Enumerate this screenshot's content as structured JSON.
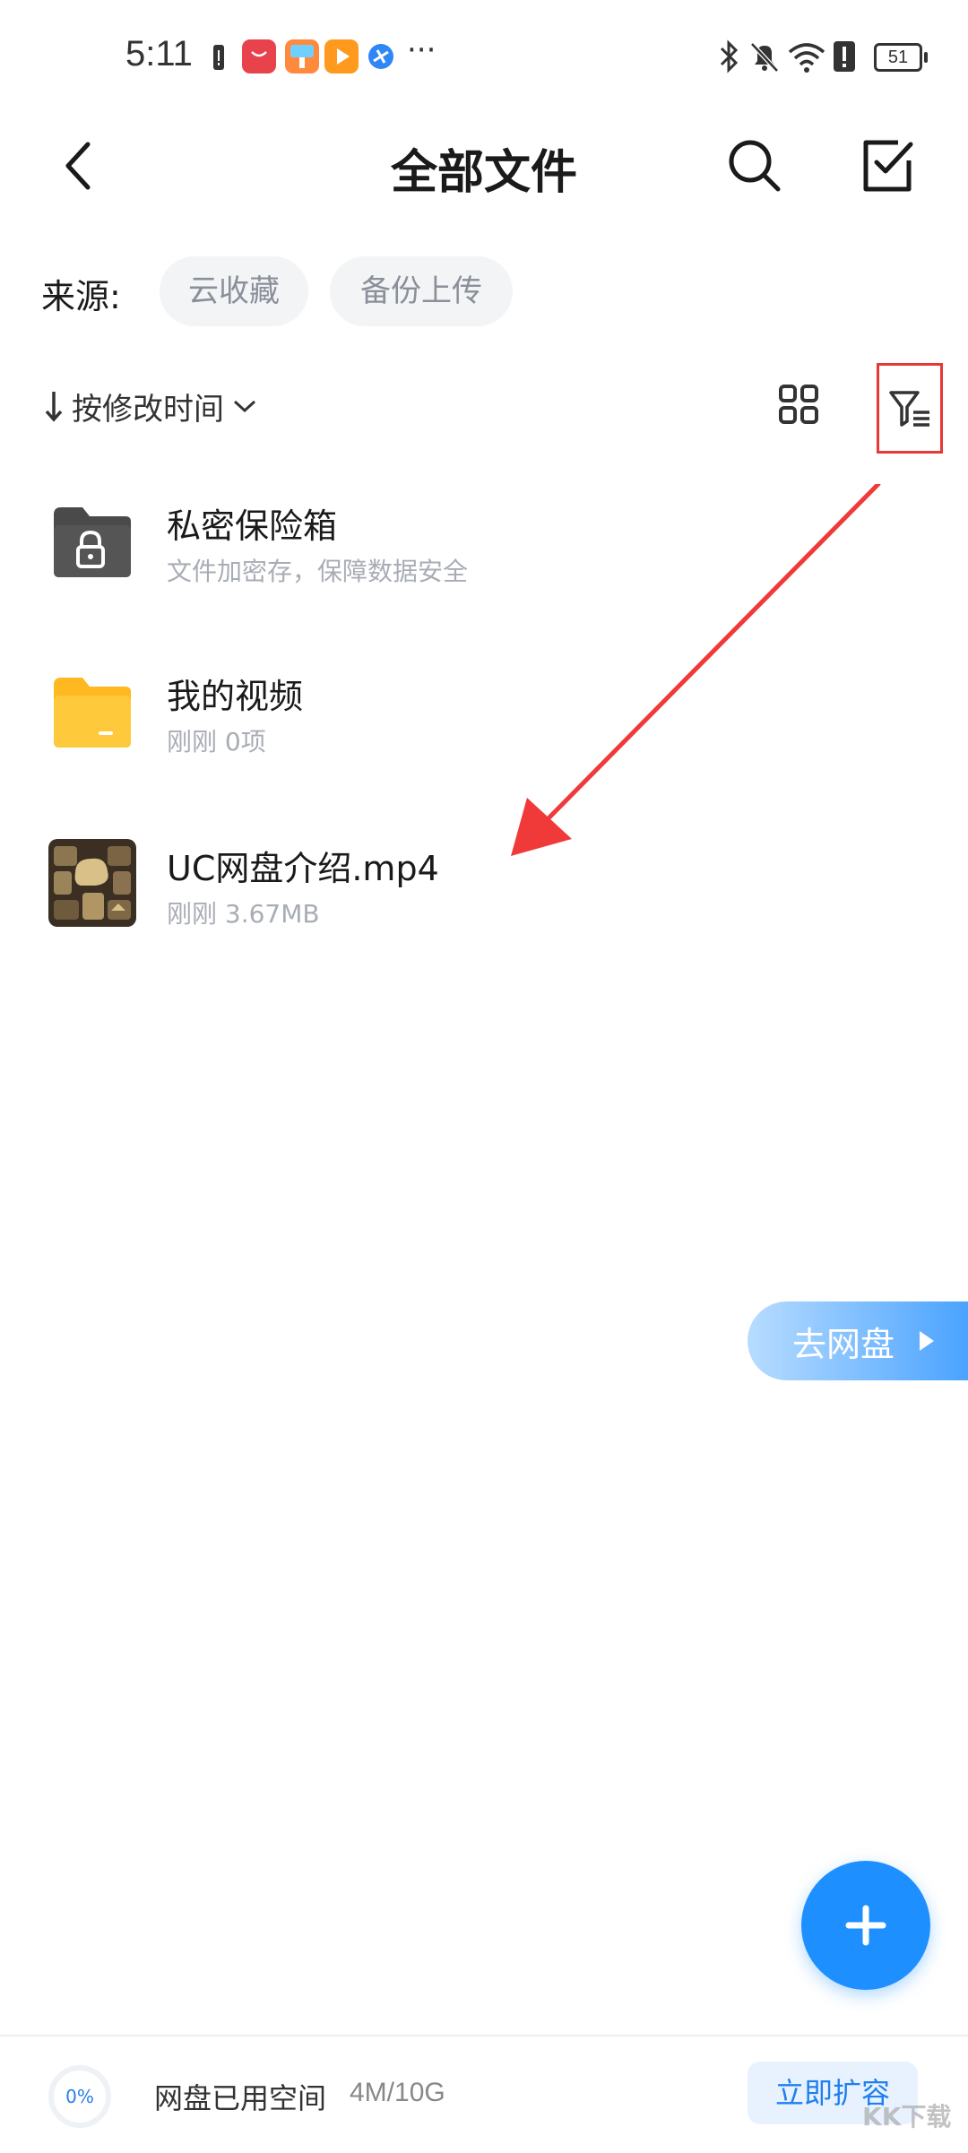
{
  "status_bar": {
    "time": "5:11",
    "more": "···",
    "battery": "51"
  },
  "header": {
    "title": "全部文件"
  },
  "source": {
    "label": "来源:",
    "chips": [
      "云收藏",
      "备份上传"
    ]
  },
  "sort": {
    "label": "按修改时间"
  },
  "files": [
    {
      "name": "私密保险箱",
      "subtitle": "文件加密存，保障数据安全",
      "icon": "lock-folder-icon"
    },
    {
      "name": "我的视频",
      "subtitle": "刚刚 0项",
      "icon": "folder-icon"
    },
    {
      "name": "UC网盘介绍.mp4",
      "subtitle": "刚刚 3.67MB",
      "icon": "video-thumbnail"
    }
  ],
  "floating": {
    "go_pan_label": "去网盘"
  },
  "bottom_bar": {
    "percent": "0%",
    "label": "网盘已用空间",
    "value": "4M/10G",
    "expand_label": "立即扩容"
  },
  "watermark": "KK下载",
  "colors": {
    "accent": "#1e8fff",
    "folder": "#ffc53d",
    "highlight": "#e53935"
  }
}
